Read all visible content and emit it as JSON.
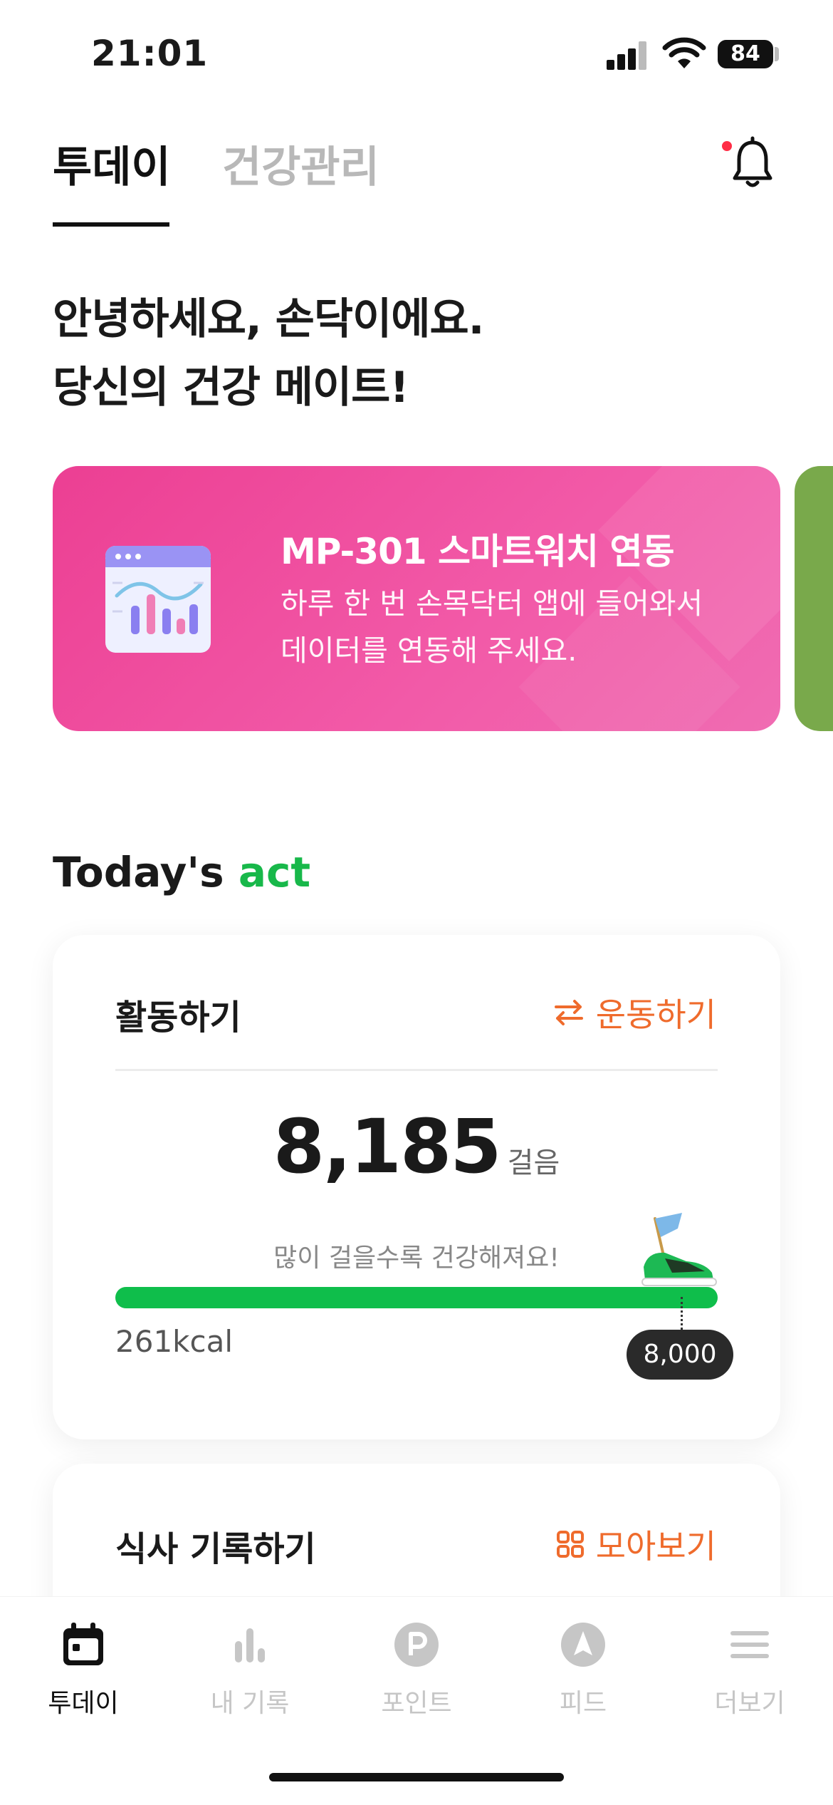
{
  "status_bar": {
    "time": "21:01",
    "battery": "84"
  },
  "top_tabs": [
    {
      "label": "투데이",
      "active": true
    },
    {
      "label": "건강관리",
      "active": false
    }
  ],
  "greeting": "안녕하세요, 손닥이에요.\n당신의 건강 메이트!",
  "banner": {
    "title": "MP-301 스마트워치 연동",
    "subtitle": "하루 한 번 손목닥터 앱에 들어와서\n데이터를 연동해 주세요.",
    "bg_color": "#ec3f93",
    "next_color": "#79a94b",
    "icon": "chart-window-icon"
  },
  "section": {
    "title_main": "Today's",
    "title_accent": "act",
    "accent_color": "#18b84a"
  },
  "activity_card": {
    "title": "활동하기",
    "action_label": "운동하기",
    "action_icon": "swap-arrows-icon",
    "steps": "8,185",
    "steps_unit": "걸음",
    "motivation": "많이 걸을수록 건강해져요!",
    "kcal": "261kcal",
    "goal": "8,000",
    "progress": 1.0,
    "accent_color": "#ef6b2c",
    "progress_color": "#0fbe4b"
  },
  "meal_card": {
    "title": "식사 기록하기",
    "action_label": "모아보기",
    "action_icon": "grid-icon"
  },
  "bottom_nav": [
    {
      "label": "투데이",
      "icon": "calendar-icon",
      "active": true
    },
    {
      "label": "내 기록",
      "icon": "bar-chart-icon",
      "active": false
    },
    {
      "label": "포인트",
      "icon": "point-coin-icon",
      "active": false
    },
    {
      "label": "피드",
      "icon": "compass-icon",
      "active": false
    },
    {
      "label": "더보기",
      "icon": "menu-icon",
      "active": false
    }
  ]
}
